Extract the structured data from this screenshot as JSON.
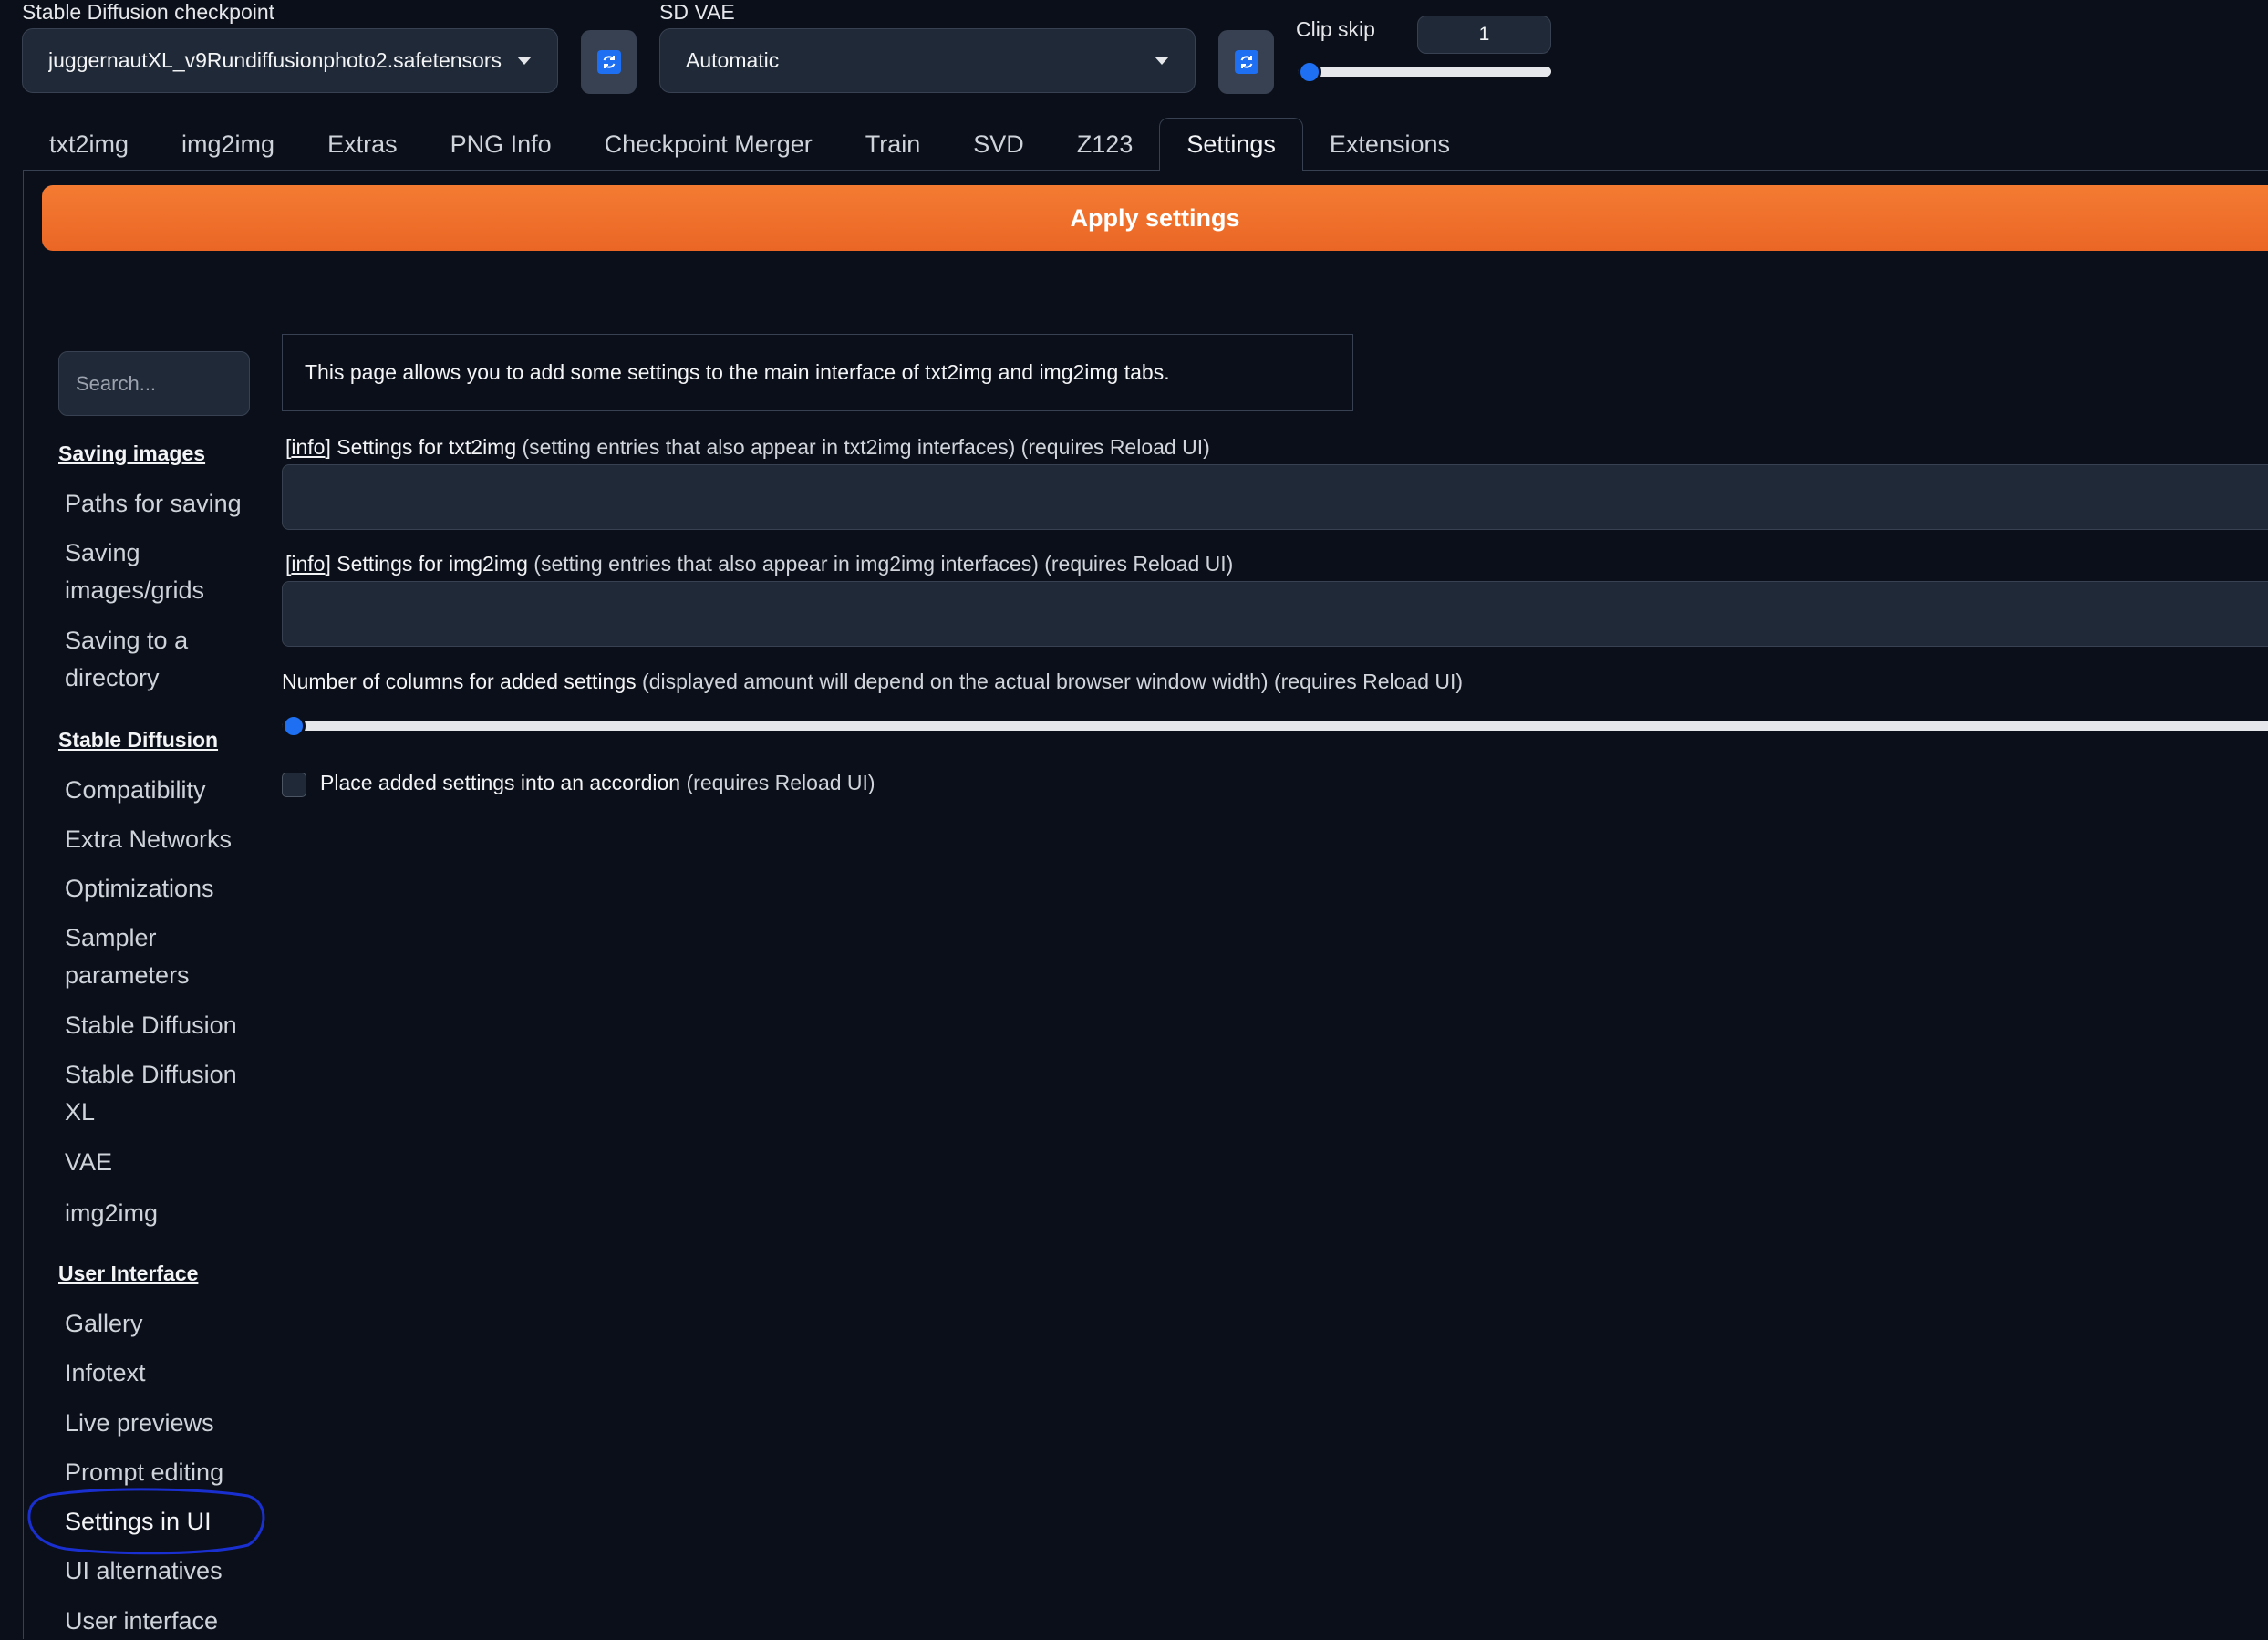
{
  "top": {
    "checkpoint_label": "Stable Diffusion checkpoint",
    "checkpoint_value": "juggernautXL_v9Rundiffusionphoto2.safetensors",
    "vae_label": "SD VAE",
    "vae_value": "Automatic",
    "clip_label": "Clip skip",
    "clip_value": "1"
  },
  "tabs": [
    {
      "label": "txt2img"
    },
    {
      "label": "img2img"
    },
    {
      "label": "Extras"
    },
    {
      "label": "PNG Info"
    },
    {
      "label": "Checkpoint Merger"
    },
    {
      "label": "Train"
    },
    {
      "label": "SVD"
    },
    {
      "label": "Z123"
    },
    {
      "label": "Settings",
      "active": true
    },
    {
      "label": "Extensions"
    }
  ],
  "apply_label": "Apply settings",
  "sidebar": {
    "search_placeholder": "Search...",
    "categories": [
      {
        "title": "Saving images",
        "items": [
          "Paths for saving",
          "Saving images/grids",
          "Saving to a directory"
        ]
      },
      {
        "title": "Stable Diffusion",
        "items": [
          "Compatibility",
          "Extra Networks",
          "Optimizations",
          "Sampler parameters",
          "Stable Diffusion",
          "Stable Diffusion XL",
          "VAE",
          "img2img"
        ]
      },
      {
        "title": "User Interface",
        "items": [
          "Gallery",
          "Infotext",
          "Live previews",
          "Prompt editing",
          "Settings in UI",
          "UI alternatives",
          "User interface"
        ]
      }
    ],
    "highlighted_item": "Settings in UI"
  },
  "main": {
    "info_text": "This page allows you to add some settings to the main interface of txt2img and img2img tabs.",
    "txt2img": {
      "link": "info",
      "name": "Settings for txt2img",
      "hint": "(setting entries that also appear in txt2img interfaces) (requires Reload UI)"
    },
    "img2img": {
      "link": "info",
      "name": "Settings for img2img",
      "hint": "(setting entries that also appear in img2img interfaces) (requires Reload UI)"
    },
    "columns": {
      "name": "Number of columns for added settings",
      "hint": "(displayed amount will depend on the actual browser window width) (requires Reload UI)",
      "value_fraction": 0
    },
    "accordion": {
      "name": "Place added settings into an accordion",
      "hint": "(requires Reload UI)",
      "checked": false
    }
  },
  "colors": {
    "accent": "#1e6ff1",
    "apply_button": "#f07230",
    "annotation": "#1a2fd0",
    "background": "#0b0f19"
  }
}
